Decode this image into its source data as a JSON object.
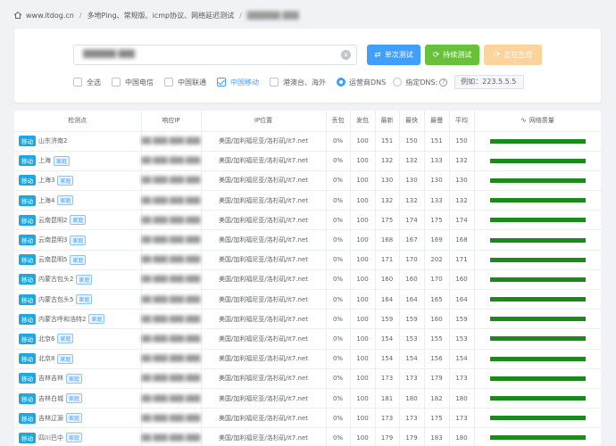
{
  "breadcrumb": {
    "site": "www.itdog.cn",
    "page": "多地Ping、常规版、icmp协议、网络延迟测试",
    "target": "██████ ███"
  },
  "search": {
    "value": "██████ ███"
  },
  "buttons": {
    "single": "单次测试",
    "continuous": "持续测试",
    "generating": "正在生成"
  },
  "filters": {
    "all": "全选",
    "telecom": "中国电信",
    "unicom": "中国联通",
    "mobile": "中国移动",
    "hkmo": "港澳台、海外"
  },
  "dns": {
    "operator": "运营商DNS",
    "custom": "指定DNS:",
    "placeholder": "例如：223.5.5.5"
  },
  "table": {
    "headers": [
      "检测点",
      "响应IP",
      "IP位置",
      "丢包",
      "发包",
      "最新",
      "最快",
      "最慢",
      "平均",
      "网络质量"
    ],
    "tag_mobile": "移动",
    "tag_home": "家庭",
    "rows": [
      {
        "name": "山东济南2",
        "home": false,
        "ip": "██.███.███.███",
        "loc": "美国/加利福尼亚/洛杉矶/it7.net",
        "loss": "0%",
        "sent": "100",
        "last": "151",
        "best": "150",
        "worst": "151",
        "avg": "150"
      },
      {
        "name": "上海",
        "home": true,
        "ip": "██.███.███.███",
        "loc": "美国/加利福尼亚/洛杉矶/it7.net",
        "loss": "0%",
        "sent": "100",
        "last": "132",
        "best": "132",
        "worst": "133",
        "avg": "132"
      },
      {
        "name": "上海3",
        "home": true,
        "ip": "██.███.███.███",
        "loc": "美国/加利福尼亚/洛杉矶/it7.net",
        "loss": "0%",
        "sent": "100",
        "last": "130",
        "best": "130",
        "worst": "130",
        "avg": "130"
      },
      {
        "name": "上海4",
        "home": true,
        "ip": "██.███.███.███",
        "loc": "美国/加利福尼亚/洛杉矶/it7.net",
        "loss": "0%",
        "sent": "100",
        "last": "132",
        "best": "132",
        "worst": "133",
        "avg": "132"
      },
      {
        "name": "云南昆明2",
        "home": true,
        "ip": "██.███.███.███",
        "loc": "美国/加利福尼亚/洛杉矶/it7.net",
        "loss": "0%",
        "sent": "100",
        "last": "175",
        "best": "174",
        "worst": "175",
        "avg": "174"
      },
      {
        "name": "云南昆明3",
        "home": true,
        "ip": "██.███.███.███",
        "loc": "美国/加利福尼亚/洛杉矶/it7.net",
        "loss": "0%",
        "sent": "100",
        "last": "168",
        "best": "167",
        "worst": "169",
        "avg": "168"
      },
      {
        "name": "云南昆明5",
        "home": true,
        "ip": "██.███.███.███",
        "loc": "美国/加利福尼亚/洛杉矶/it7.net",
        "loss": "0%",
        "sent": "100",
        "last": "171",
        "best": "170",
        "worst": "202",
        "avg": "171"
      },
      {
        "name": "内蒙古包头2",
        "home": true,
        "ip": "██.███.███.███",
        "loc": "美国/加利福尼亚/洛杉矶/it7.net",
        "loss": "0%",
        "sent": "100",
        "last": "160",
        "best": "160",
        "worst": "170",
        "avg": "160"
      },
      {
        "name": "内蒙古包头5",
        "home": true,
        "ip": "██.███.███.███",
        "loc": "美国/加利福尼亚/洛杉矶/it7.net",
        "loss": "0%",
        "sent": "100",
        "last": "164",
        "best": "164",
        "worst": "165",
        "avg": "164"
      },
      {
        "name": "内蒙古呼和浩特2",
        "home": true,
        "ip": "██.███.███.███",
        "loc": "美国/加利福尼亚/洛杉矶/it7.net",
        "loss": "0%",
        "sent": "100",
        "last": "159",
        "best": "159",
        "worst": "160",
        "avg": "159"
      },
      {
        "name": "北京6",
        "home": true,
        "ip": "██.███.███.███",
        "loc": "美国/加利福尼亚/洛杉矶/it7.net",
        "loss": "0%",
        "sent": "100",
        "last": "154",
        "best": "153",
        "worst": "155",
        "avg": "153"
      },
      {
        "name": "北京8",
        "home": true,
        "ip": "██.███.███.███",
        "loc": "美国/加利福尼亚/洛杉矶/it7.net",
        "loss": "0%",
        "sent": "100",
        "last": "154",
        "best": "154",
        "worst": "156",
        "avg": "154"
      },
      {
        "name": "吉林吉林",
        "home": true,
        "ip": "██.███.███.███",
        "loc": "美国/加利福尼亚/洛杉矶/it7.net",
        "loss": "0%",
        "sent": "100",
        "last": "173",
        "best": "173",
        "worst": "179",
        "avg": "173"
      },
      {
        "name": "吉林白城",
        "home": true,
        "ip": "██.███.███.███",
        "loc": "美国/加利福尼亚/洛杉矶/it7.net",
        "loss": "0%",
        "sent": "100",
        "last": "181",
        "best": "180",
        "worst": "182",
        "avg": "180"
      },
      {
        "name": "吉林辽源",
        "home": true,
        "ip": "██.███.███.███",
        "loc": "美国/加利福尼亚/洛杉矶/it7.net",
        "loss": "0%",
        "sent": "100",
        "last": "173",
        "best": "173",
        "worst": "175",
        "avg": "173"
      },
      {
        "name": "四川巴中",
        "home": true,
        "ip": "██.███.███.███",
        "loc": "美国/加利福尼亚/洛杉矶/it7.net",
        "loss": "0%",
        "sent": "100",
        "last": "179",
        "best": "179",
        "worst": "183",
        "avg": "180"
      }
    ]
  }
}
